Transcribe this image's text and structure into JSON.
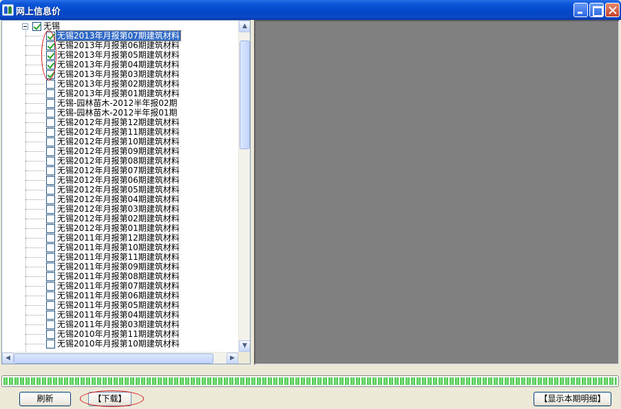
{
  "window": {
    "title": "网上信息价"
  },
  "tree": {
    "root": {
      "label": "无锡",
      "checked": true
    },
    "items": [
      {
        "label": "无锡2013年月报第07期建筑材料",
        "checked": true,
        "selected": true
      },
      {
        "label": "无锡2013年月报第06期建筑材料",
        "checked": true
      },
      {
        "label": "无锡2013年月报第05期建筑材料",
        "checked": true
      },
      {
        "label": "无锡2013年月报第04期建筑材料",
        "checked": true
      },
      {
        "label": "无锡2013年月报第03期建筑材料",
        "checked": true
      },
      {
        "label": "无锡2013年月报第02期建筑材料",
        "checked": false
      },
      {
        "label": "无锡2013年月报第01期建筑材料",
        "checked": false
      },
      {
        "label": "无锡-园林苗木-2012半年报02期",
        "checked": false
      },
      {
        "label": "无锡-园林苗木-2012半年报01期",
        "checked": false
      },
      {
        "label": "无锡2012年月报第12期建筑材料",
        "checked": false
      },
      {
        "label": "无锡2012年月报第11期建筑材料",
        "checked": false
      },
      {
        "label": "无锡2012年月报第10期建筑材料",
        "checked": false
      },
      {
        "label": "无锡2012年月报第09期建筑材料",
        "checked": false
      },
      {
        "label": "无锡2012年月报第08期建筑材料",
        "checked": false
      },
      {
        "label": "无锡2012年月报第07期建筑材料",
        "checked": false
      },
      {
        "label": "无锡2012年月报第06期建筑材料",
        "checked": false
      },
      {
        "label": "无锡2012年月报第05期建筑材料",
        "checked": false
      },
      {
        "label": "无锡2012年月报第04期建筑材料",
        "checked": false
      },
      {
        "label": "无锡2012年月报第03期建筑材料",
        "checked": false
      },
      {
        "label": "无锡2012年月报第02期建筑材料",
        "checked": false
      },
      {
        "label": "无锡2012年月报第01期建筑材料",
        "checked": false
      },
      {
        "label": "无锡2011年月报第12期建筑材料",
        "checked": false
      },
      {
        "label": "无锡2011年月报第10期建筑材料",
        "checked": false
      },
      {
        "label": "无锡2011年月报第11期建筑材料",
        "checked": false
      },
      {
        "label": "无锡2011年月报第09期建筑材料",
        "checked": false
      },
      {
        "label": "无锡2011年月报第08期建筑材料",
        "checked": false
      },
      {
        "label": "无锡2011年月报第07期建筑材料",
        "checked": false
      },
      {
        "label": "无锡2011年月报第06期建筑材料",
        "checked": false
      },
      {
        "label": "无锡2011年月报第05期建筑材料",
        "checked": false
      },
      {
        "label": "无锡2011年月报第04期建筑材料",
        "checked": false
      },
      {
        "label": "无锡2011年月报第03期建筑材料",
        "checked": false
      },
      {
        "label": "无锡2010年月报第11期建筑材料",
        "checked": false
      },
      {
        "label": "无锡2010年月报第10期建筑材料",
        "checked": false
      }
    ],
    "scrollbar_icons": {
      "up": "arrow-up-icon",
      "down": "arrow-down-icon",
      "left": "arrow-left-icon",
      "right": "arrow-right-icon"
    }
  },
  "progress": {
    "value": 1.0,
    "color": "#36c33c"
  },
  "buttons": {
    "refresh": "刷新",
    "download": "【下载】",
    "show_details": "【显示本期明细】"
  },
  "colors": {
    "selection": "#316ac5",
    "annotation": "#d7141a",
    "preview_bg": "#808080"
  }
}
